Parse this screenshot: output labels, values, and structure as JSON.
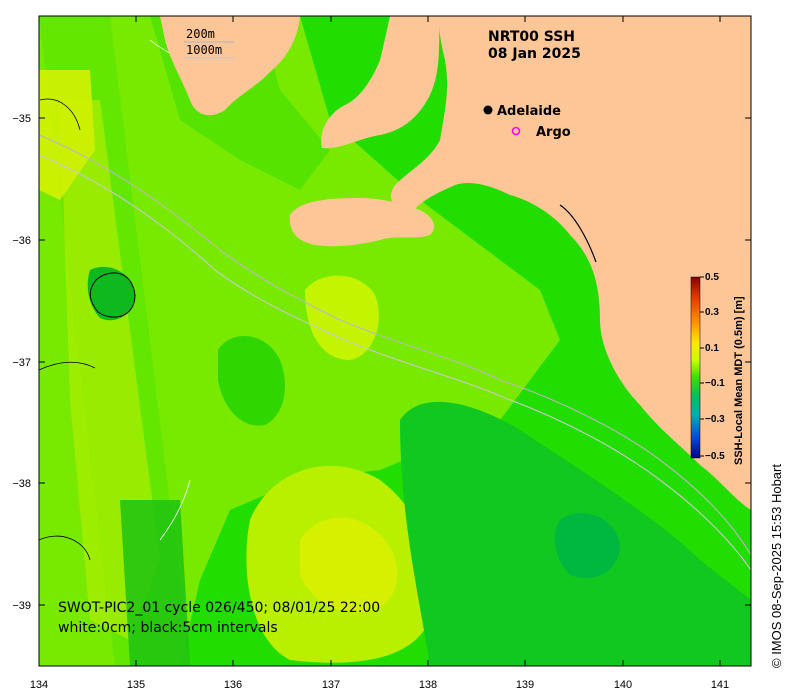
{
  "map": {
    "title_line1": "NRT00 SSH",
    "title_line2": "08 Jan 2025",
    "land_color": "#fdc697",
    "ocean_color": "#22dd00"
  },
  "axes": {
    "lon_ticks": [
      "134",
      "135",
      "136",
      "137",
      "138",
      "139",
      "140",
      "141"
    ],
    "lat_ticks": [
      "−35",
      "−36",
      "−37",
      "−38",
      "−39"
    ]
  },
  "scale_bar": {
    "label_200": "200m",
    "label_1000": "1000m"
  },
  "legend": {
    "adelaide_label": "Adelaide",
    "argo_label": "Argo",
    "argo_color": "#ff00ff"
  },
  "swot": {
    "line1": "SWOT-PIC2_01 cycle 026/450; 08/01/25 22:00",
    "line2": "white:0cm; black:5cm intervals"
  },
  "colorbar": {
    "title": "SSH-Local Mean MDT (0.5m) [m]",
    "ticks": [
      "0.5",
      "0.3",
      "0.1",
      "−0.1",
      "−0.3",
      "−0.5"
    ]
  },
  "credit": "© IMOS 08-Sep-2025 15:53 Hobart"
}
